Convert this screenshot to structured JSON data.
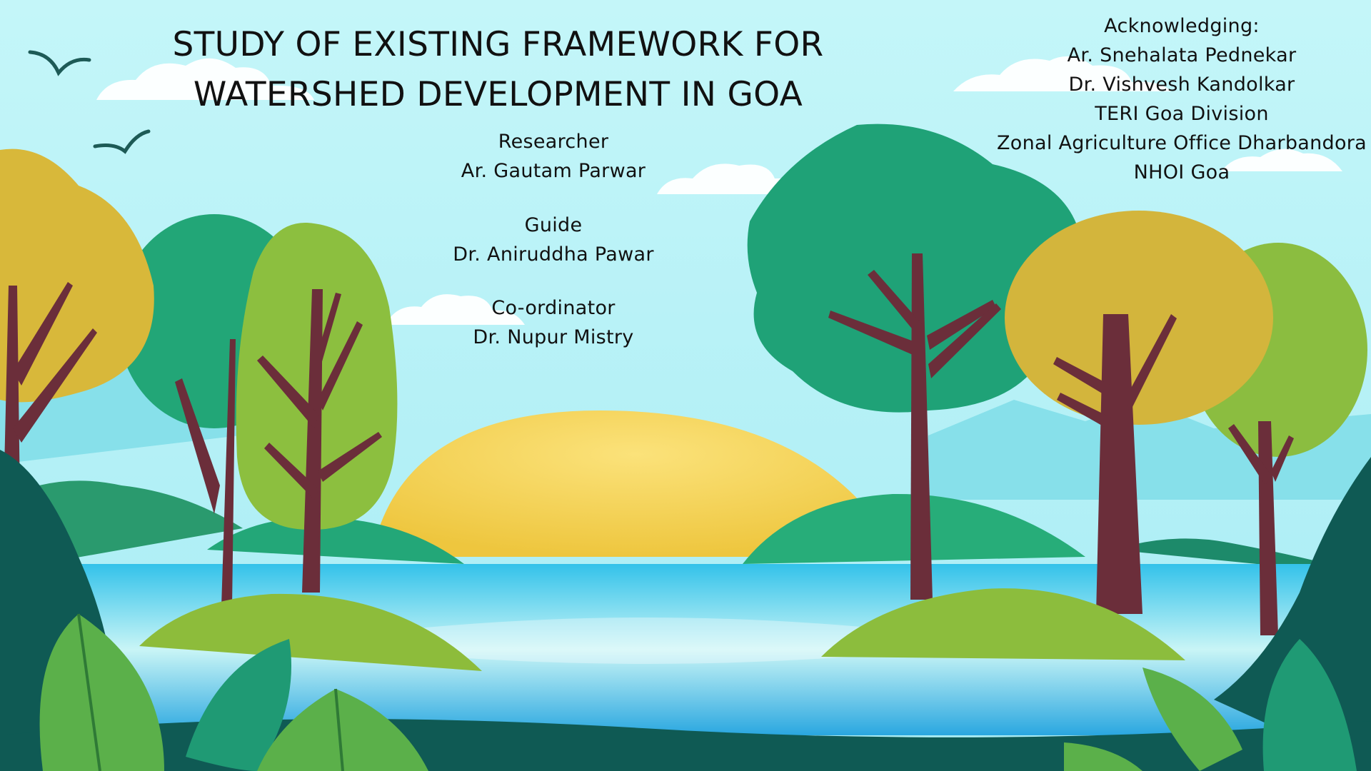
{
  "slide": {
    "title_lines": [
      "STUDY OF EXISTING FRAMEWORK FOR",
      "WATERSHED DEVELOPMENT IN GOA"
    ],
    "researcher": {
      "role": "Researcher",
      "name": "Ar. Gautam Parwar"
    },
    "guide": {
      "role": "Guide",
      "name": "Dr. Aniruddha Pawar"
    },
    "coordinator": {
      "role": "Co-ordinator",
      "name": "Dr. Nupur Mistry"
    },
    "acknowledgements": {
      "heading": "Acknowledging:",
      "items": [
        "Ar. Snehalata Pednekar",
        "Dr. Vishvesh Kandolkar",
        "TERI Goa Division",
        "Zonal Agriculture Office Dharbandora",
        "NHOI Goa"
      ]
    }
  },
  "colors": {
    "sky": "#bff3f7",
    "sun": "#f6d55c",
    "water": "#3cc6e8",
    "trunk": "#6b2e3a",
    "dark_foliage": "#0f5a54",
    "green_foliage": "#22a877",
    "yellow_foliage": "#d9b93a",
    "lime_foliage": "#8cbf3f"
  }
}
